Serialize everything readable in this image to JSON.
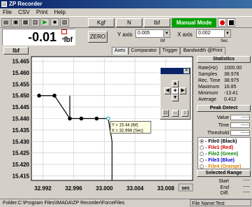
{
  "window": {
    "title": "ZP Recorder"
  },
  "menu": [
    "File",
    "CSV",
    "Print",
    "Help"
  ],
  "toolbar": {
    "unit_buttons": [
      "Kgf",
      "N",
      "lbf"
    ],
    "manual_mode": "Manual Mode"
  },
  "readout": {
    "value": "-0.01",
    "unit": "lbf",
    "plusminus": "+/-"
  },
  "zero_button": "ZERO",
  "y_axis": {
    "label": "Y axis",
    "value": "0.005",
    "unit": "lbf"
  },
  "x_axis": {
    "label": "X axis",
    "value": "0.002",
    "unit": "Sec"
  },
  "unit_tag": "lbf",
  "tabs": [
    "Axes",
    "Comparator",
    "Trigger",
    "Bandwidth @Print"
  ],
  "chart_data": {
    "type": "line",
    "x_ticks": [
      "32.992",
      "32.996",
      "33.000",
      "33.004",
      "33.008"
    ],
    "y_ticks": [
      "15.465",
      "15.460",
      "15.455",
      "15.450",
      "15.445",
      "15.440",
      "15.435",
      "15.430",
      "15.425",
      "15.420",
      "15.415"
    ],
    "x_unit_label": "sec",
    "ylim": [
      15.413,
      15.467
    ],
    "xlim": [
      32.9905,
      33.0115
    ],
    "series": [
      {
        "x": [
          32.9915,
          32.9935,
          32.9955,
          32.997,
          32.999,
          33.0005
        ],
        "y": [
          15.45,
          15.45,
          15.44,
          15.44,
          15.44,
          15.44
        ]
      },
      {
        "x": [
          32.9955,
          32.9955
        ],
        "y": [
          15.45,
          15.44
        ]
      },
      {
        "x": [
          33.0005,
          33.001,
          33.001
        ],
        "y": [
          15.44,
          15.43,
          15.413
        ]
      }
    ],
    "tooltip": {
      "y_text": "Y = 15.44 (lbf)",
      "x_text": "X = 32.998 (Sec)"
    }
  },
  "stats": {
    "header": "Statistics",
    "rows": [
      {
        "k": "Rate(Hz)",
        "v": "1000.00"
      },
      {
        "k": "Samples",
        "v": "38.976"
      },
      {
        "k": "Rec. Time",
        "v": "38.975"
      },
      {
        "k": "Maximum",
        "v": "16.85"
      },
      {
        "k": "Minimum",
        "v": "-13.41"
      },
      {
        "k": "Average",
        "v": "0.412"
      }
    ]
  },
  "peak": {
    "header": "Peak Detect",
    "rows": [
      {
        "k": "Value",
        "v": "------"
      },
      {
        "k": "Time",
        "v": "------"
      },
      {
        "k": "Threshold",
        "v": "------"
      }
    ]
  },
  "files": [
    {
      "label": "- File0 (Black)",
      "color": "#000000"
    },
    {
      "label": "- File1 (Red)",
      "color": "#d00000"
    },
    {
      "label": "- File2 (Green)",
      "color": "#008000"
    },
    {
      "label": "- File3 (Blue)",
      "color": "#0000d0"
    },
    {
      "label": "- File4 (Orange)",
      "color": "#e08000"
    }
  ],
  "range": {
    "header": "Selected Range",
    "rows": [
      {
        "k": "Start",
        "v": "-----"
      },
      {
        "k": "End",
        "v": "-----"
      },
      {
        "k": "Diff.",
        "v": "-----"
      }
    ]
  },
  "status": {
    "folder": "Folder:C:\\Program Files\\IMADA\\ZP Recorder\\ForceFiles",
    "filename": "File Name:Test"
  }
}
